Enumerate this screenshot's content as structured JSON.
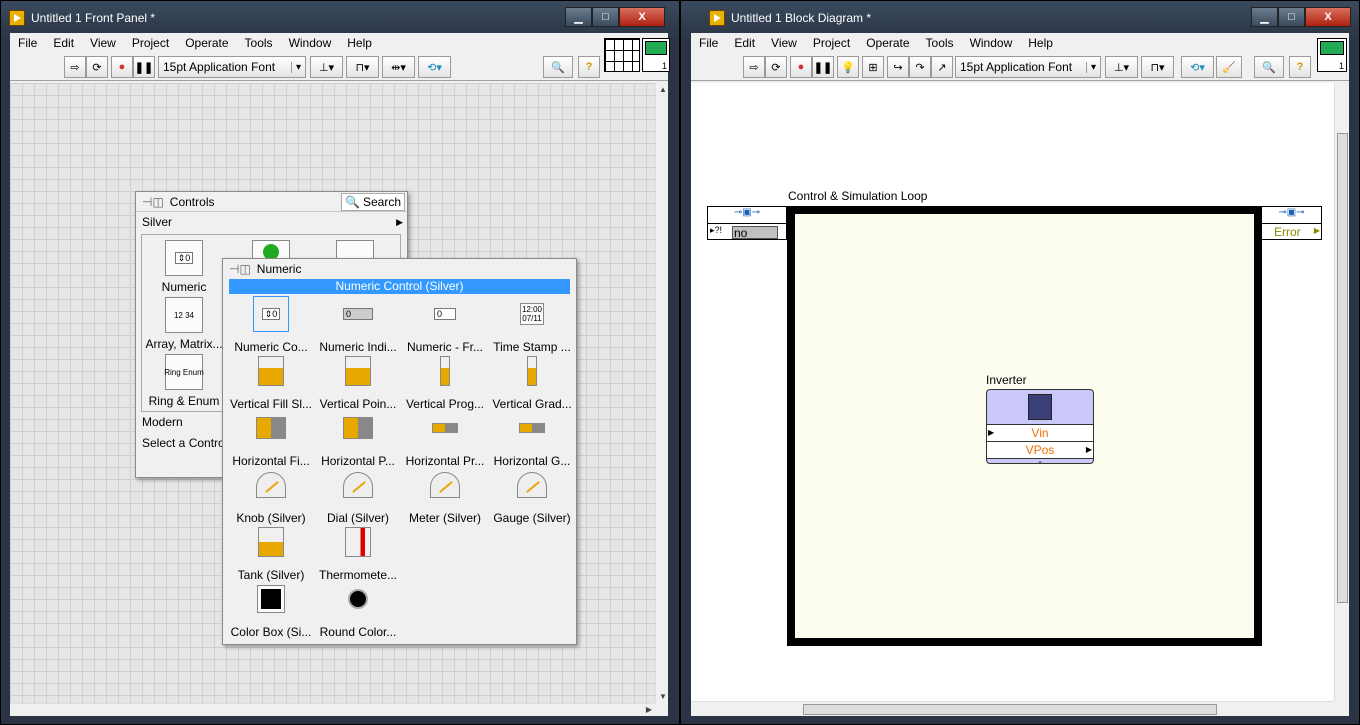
{
  "front_panel": {
    "title": "Untitled 1 Front Panel *",
    "menu": [
      "File",
      "Edit",
      "View",
      "Project",
      "Operate",
      "Tools",
      "Window",
      "Help"
    ],
    "font": "15pt Application Font",
    "connector_pane_number": "1"
  },
  "controls_palette": {
    "title": "Controls",
    "search_label": "Search",
    "category": "Silver",
    "items": [
      "Numeric",
      "Array, Matrix...",
      "Ring & Enum"
    ],
    "categories_below": [
      "Modern",
      "Select a Control..."
    ]
  },
  "numeric_palette": {
    "title": "Numeric",
    "highlight": "Numeric Control (Silver)",
    "items": [
      "Numeric Co...",
      "Numeric Indi...",
      "Numeric - Fr...",
      "Time Stamp ...",
      "Vertical Fill Sl...",
      "Vertical Poin...",
      "Vertical Prog...",
      "Vertical Grad...",
      "Horizontal Fi...",
      "Horizontal P...",
      "Horizontal Pr...",
      "Horizontal G...",
      "Knob (Silver)",
      "Dial (Silver)",
      "Meter (Silver)",
      "Gauge (Silver)",
      "Tank (Silver)",
      "Thermomete...",
      "Color Box (Si...",
      "Round Color..."
    ],
    "sample_values": {
      "numeric": "0",
      "time": "12:00",
      "date": "07/11"
    }
  },
  "block_diagram": {
    "title": "Untitled 1 Block Diagram *",
    "menu": [
      "File",
      "Edit",
      "View",
      "Project",
      "Operate",
      "Tools",
      "Window",
      "Help"
    ],
    "font": "15pt Application Font",
    "connector_pane_number": "1",
    "loop_label": "Control & Simulation Loop",
    "left_tunnel_value": "no",
    "right_tunnel_value": "Error",
    "node": {
      "label": "Inverter",
      "inputs": [
        "Vin"
      ],
      "outputs": [
        "VPos"
      ]
    }
  },
  "colors": {
    "highlight": "#3399ff",
    "loop_bg": "#fdfdef",
    "node_bg": "#c9c8f8",
    "terminal_text": "#f07000"
  }
}
